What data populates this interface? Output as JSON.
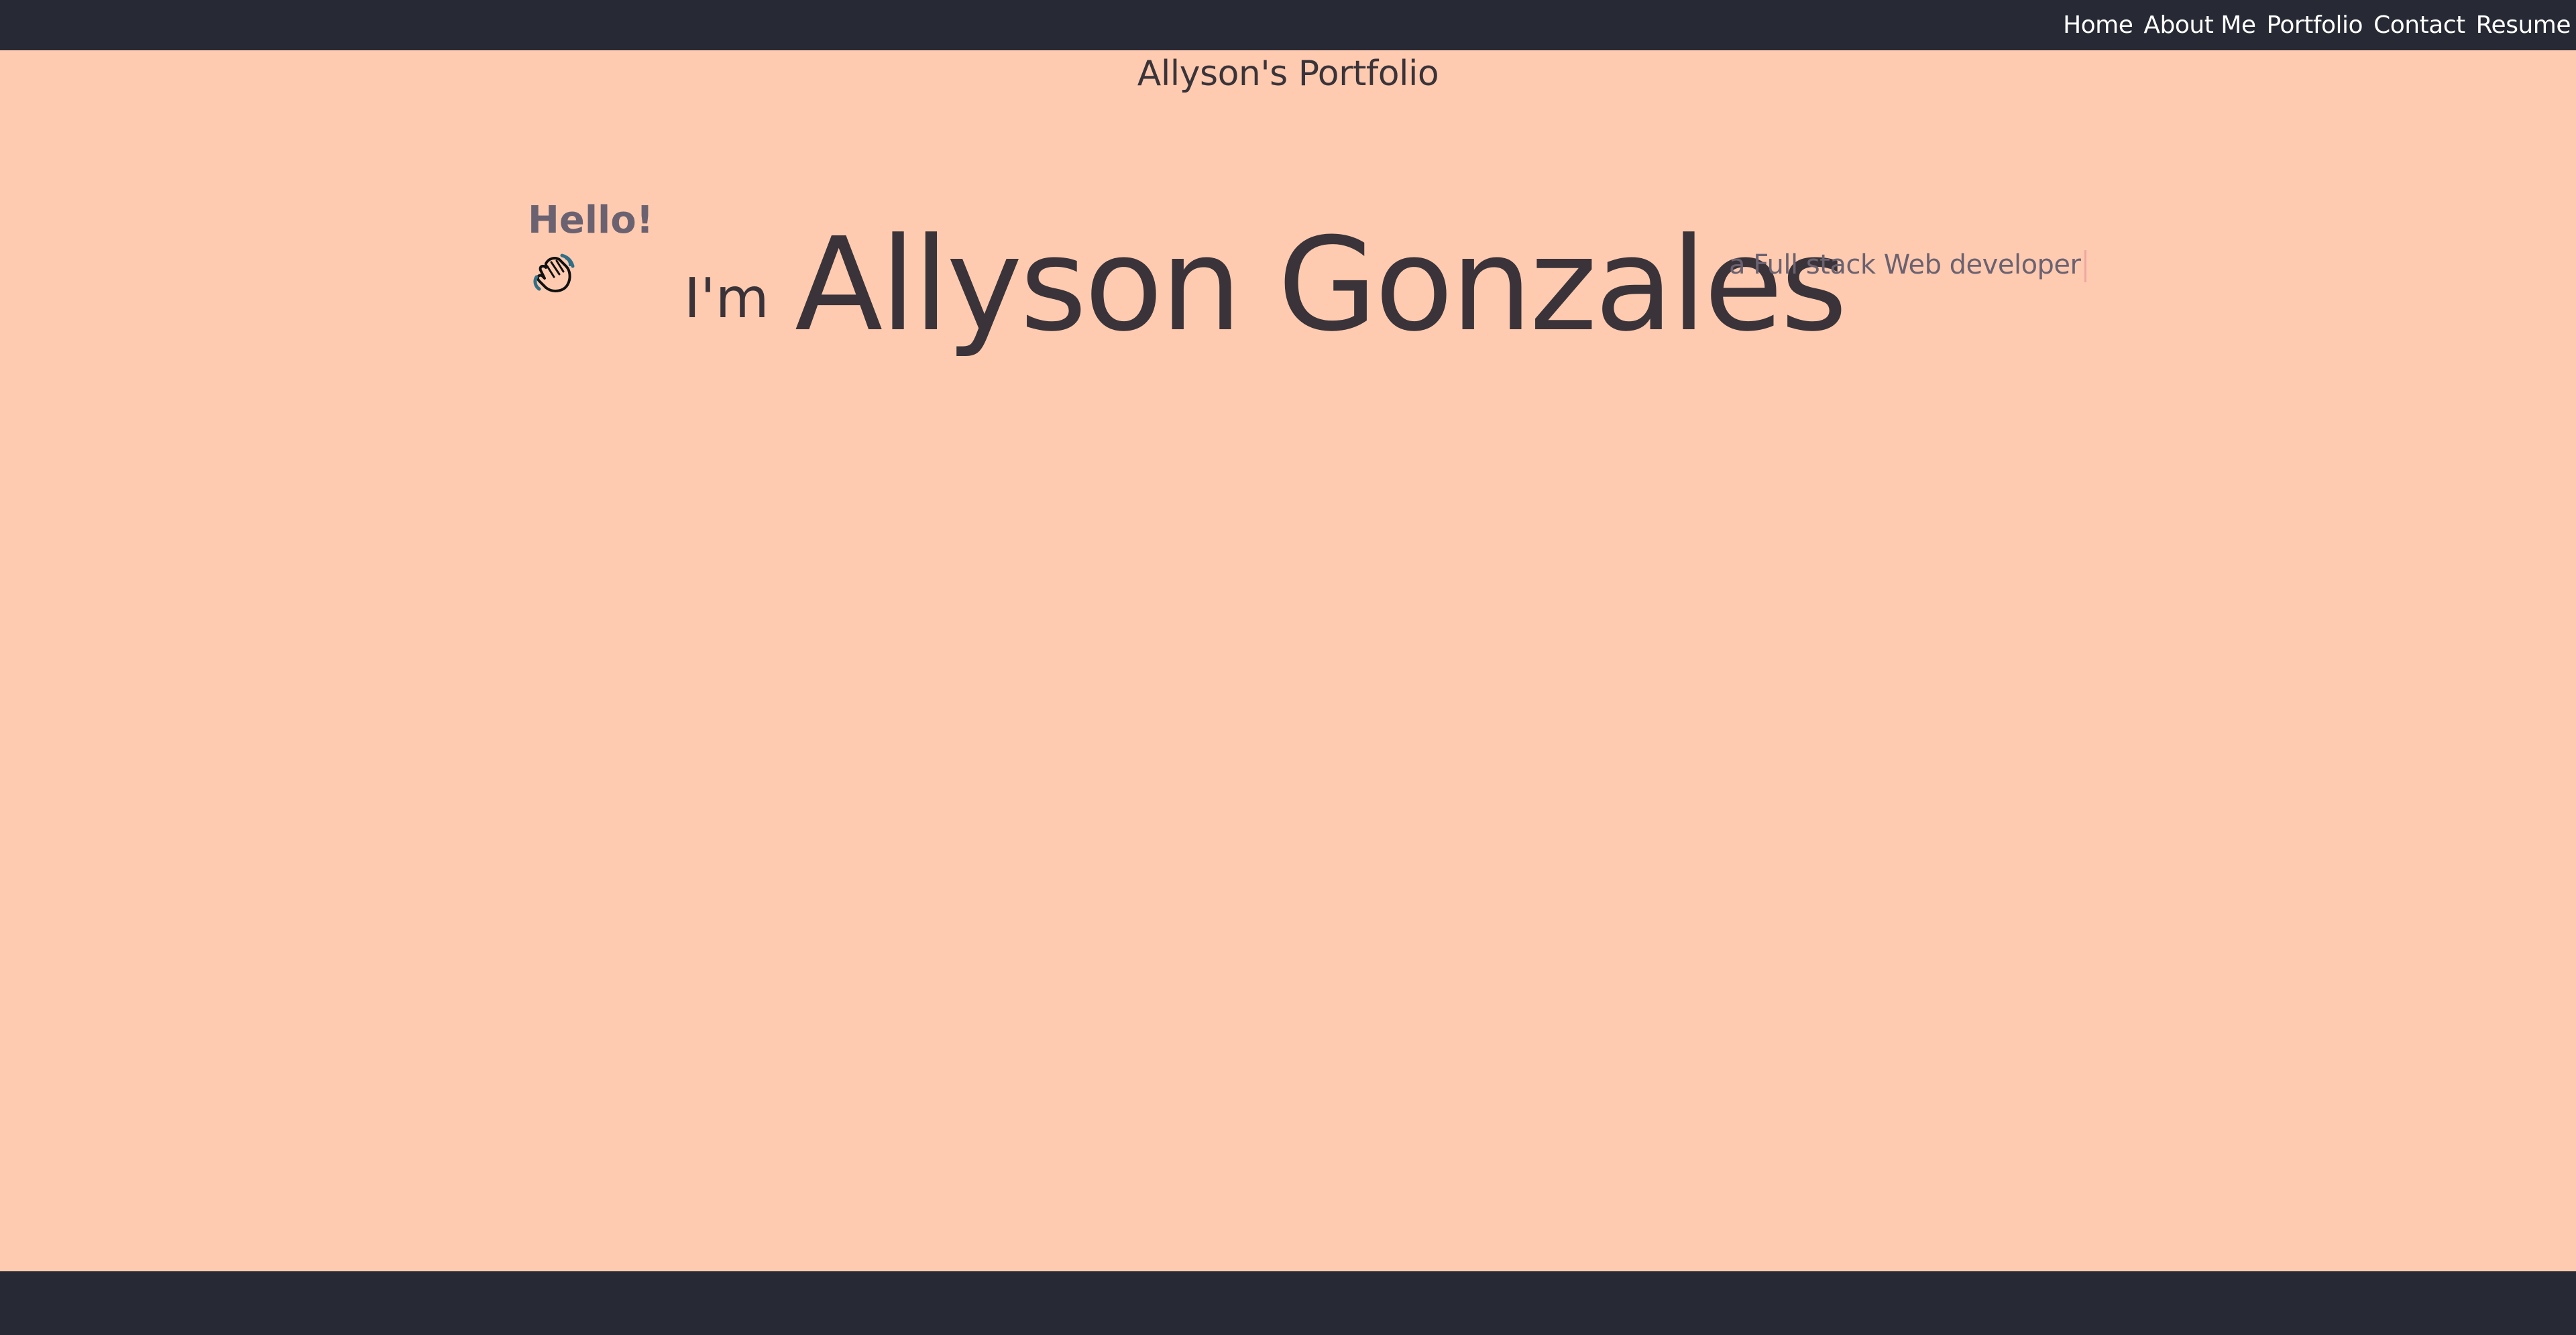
{
  "colors": {
    "navbar_bg": "#272a34",
    "page_bg": "#ffcbb0",
    "heading_text": "#3a343a",
    "muted_text": "#6b6271",
    "nav_text": "#ffffff",
    "cursor": "#f0a7a0"
  },
  "nav": {
    "items": [
      {
        "label": "Home"
      },
      {
        "label": "About Me"
      },
      {
        "label": "Portfolio"
      },
      {
        "label": "Contact"
      },
      {
        "label": "Resume"
      }
    ]
  },
  "header": {
    "title": "Allyson's Portfolio"
  },
  "hero": {
    "greeting": "Hello!",
    "greeting_icon": "waving-hand-icon",
    "intro": "I'm",
    "name": "Allyson Gonzales",
    "tagline": "a Full stack Web developer"
  }
}
